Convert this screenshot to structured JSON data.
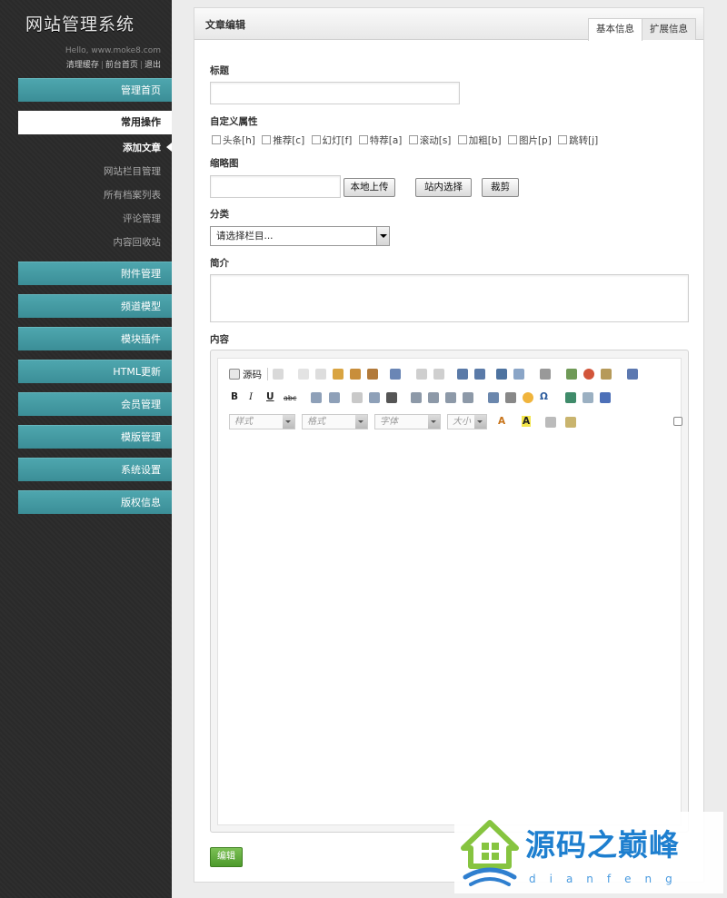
{
  "sidebar": {
    "brand": "网站管理系统",
    "hello": "Hello, www.moke8.com",
    "links": {
      "clear_cache": "清理缓存",
      "front_home": "前台首页",
      "logout": "退出",
      "sep": "|"
    },
    "nav": {
      "home": "管理首页",
      "common_ops": "常用操作",
      "sub_items": [
        "添加文章",
        "网站栏目管理",
        "所有档案列表",
        "评论管理",
        "内容回收站"
      ],
      "attachment": "附件管理",
      "channel_model": "频道模型",
      "module_plugin": "模块插件",
      "html_update": "HTML更新",
      "member": "会员管理",
      "template": "模版管理",
      "system": "系统设置",
      "copyright": "版权信息"
    }
  },
  "panel": {
    "title": "文章编辑",
    "tabs": [
      "基本信息",
      "扩展信息"
    ],
    "fields": {
      "title_label": "标题",
      "title_value": "",
      "custom_attr_label": "自定义属性",
      "custom_attrs": [
        "头条[h]",
        "推荐[c]",
        "幻灯[f]",
        "特荐[a]",
        "滚动[s]",
        "加粗[b]",
        "图片[p]",
        "跳转[j]"
      ],
      "thumb_label": "缩略图",
      "thumb_value": "",
      "upload_local": "本地上传",
      "select_site": "站内选择",
      "crop": "裁剪",
      "category_label": "分类",
      "category_selected": "请选择栏目...",
      "summary_label": "简介",
      "summary_value": "",
      "content_label": "内容"
    },
    "editor": {
      "source_label": "源码",
      "combos": [
        "样式",
        "格式",
        "字体",
        "大小"
      ]
    },
    "save_button": "编辑"
  },
  "watermark": {
    "text": "源码之巅峰",
    "pinyin": "dianfeng"
  }
}
